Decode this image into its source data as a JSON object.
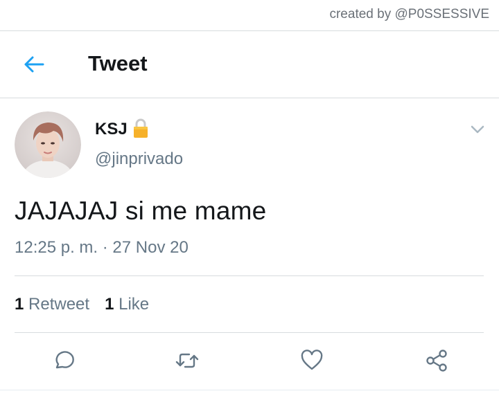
{
  "credit": "created by @P0SSESSIVE",
  "header": {
    "title": "Tweet",
    "back_icon": "arrow-left-icon"
  },
  "tweet": {
    "display_name": "KSJ",
    "locked_icon": "lock-icon",
    "handle": "@jinprivado",
    "text": "JAJAJAJ si me mame",
    "timestamp": "12:25 p. m. · 27 Nov 20",
    "menu_icon": "chevron-down-icon"
  },
  "stats": {
    "retweets_count": "1",
    "retweets_label": "Retweet",
    "likes_count": "1",
    "likes_label": "Like"
  },
  "actions": [
    "reply-icon",
    "retweet-icon",
    "like-icon",
    "share-icon"
  ],
  "colors": {
    "accent": "#1da1f2",
    "secondary_text": "#657786",
    "divider": "#d7dbde"
  }
}
